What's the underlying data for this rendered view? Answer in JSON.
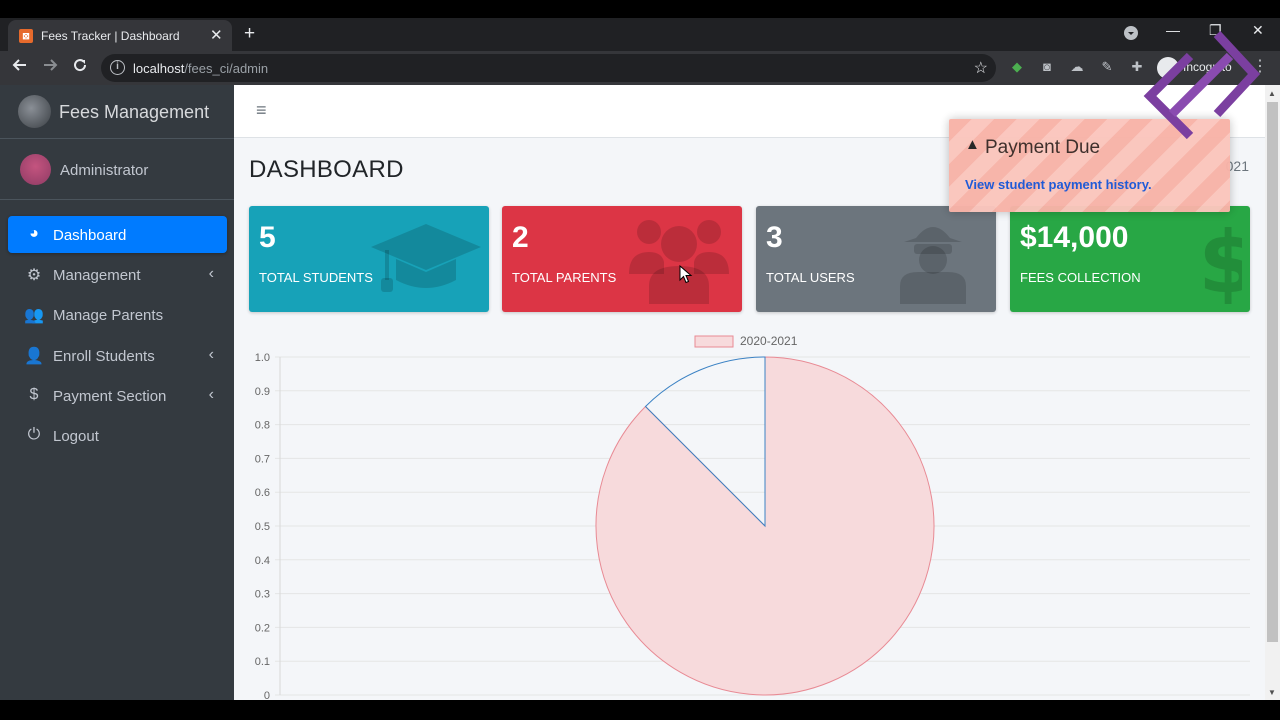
{
  "browser": {
    "tab_title": "Fees Tracker | Dashboard",
    "favicon_glyph": "⊠",
    "tab_close": "✕",
    "new_tab": "+",
    "url_host": "localhost",
    "url_path": "/fees_ci/admin",
    "incognito_label": "Incognito",
    "window_minimize": "—",
    "window_restore": "❐",
    "window_close": "✕"
  },
  "sidebar": {
    "brand": "Fees Management",
    "user": "Administrator",
    "items": [
      {
        "label": "Dashboard",
        "icon": "tachometer-icon",
        "glyph": "◕",
        "active": true,
        "has_children": false
      },
      {
        "label": "Management",
        "icon": "cogs-icon",
        "glyph": "⚙",
        "active": false,
        "has_children": true
      },
      {
        "label": "Manage Parents",
        "icon": "users-icon",
        "glyph": "👥",
        "active": false,
        "has_children": false
      },
      {
        "label": "Enroll Students",
        "icon": "user-plus-icon",
        "glyph": "👤",
        "active": false,
        "has_children": true
      },
      {
        "label": "Payment Section",
        "icon": "dollar-icon",
        "glyph": "$",
        "active": false,
        "has_children": true
      },
      {
        "label": "Logout",
        "icon": "power-icon",
        "glyph": "⏻",
        "active": false,
        "has_children": false
      }
    ],
    "chevron": "‹"
  },
  "header": {
    "menu_glyph": "≡"
  },
  "page": {
    "title": "DASHBOARD",
    "breadcrumb_fragment": "021"
  },
  "stats": [
    {
      "value": "5",
      "label": "TOTAL STUDENTS",
      "color": "#17a2b8",
      "icon": "graduation-cap-icon"
    },
    {
      "value": "2",
      "label": "TOTAL PARENTS",
      "color": "#dc3545",
      "icon": "users-icon"
    },
    {
      "value": "3",
      "label": "TOTAL USERS",
      "color": "#6c757d",
      "icon": "user-secret-icon"
    },
    {
      "value": "$14,000",
      "label": "FEES COLLECTION",
      "color": "#28a745",
      "icon": "dollar-icon"
    }
  ],
  "toast": {
    "warn_glyph": "▲",
    "title": "Payment Due",
    "link": "View student payment history."
  },
  "chart_data": {
    "type": "pie",
    "legend": [
      "2020-2021"
    ],
    "legend_position": "top",
    "series": [
      {
        "name": "2020-2021",
        "values": [
          0.875,
          0.125
        ]
      }
    ],
    "y_ticks": [
      "1.0",
      "0.9",
      "0.8",
      "0.7",
      "0.6",
      "0.5",
      "0.4",
      "0.3",
      "0.2",
      "0.1",
      "0"
    ],
    "ylim": [
      0,
      1.0
    ],
    "grid": true,
    "colors": {
      "fill": "#f7dadc",
      "stroke": "#e88a94",
      "slice_edge": "#3b82c4"
    }
  }
}
